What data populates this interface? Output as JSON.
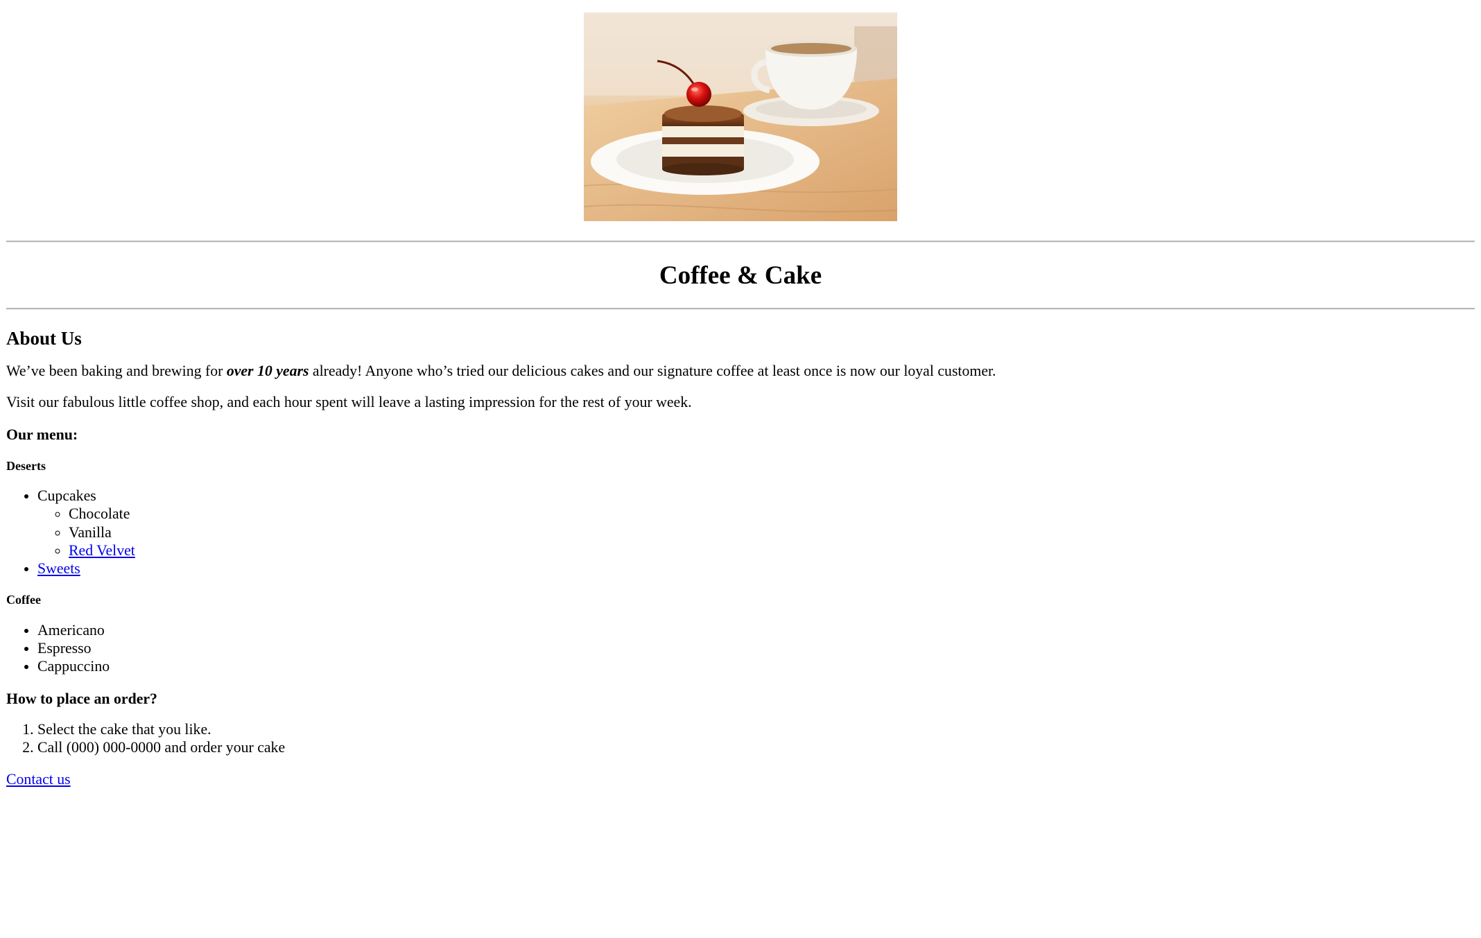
{
  "page": {
    "hero_alt": "Cake with a cherry on a plate and a cup of coffee",
    "title": "Coffee & Cake"
  },
  "about": {
    "heading": "About Us",
    "p1_pre": "We’ve been baking and brewing for ",
    "p1_em": "over 10 years",
    "p1_post": " already! Anyone who’s tried our delicious cakes and our signature coffee at least once is now our loyal customer.",
    "p2": "Visit our fabulous little coffee shop, and each hour spent will leave a lasting impression for the rest of your week."
  },
  "menu": {
    "heading": "Our menu:",
    "deserts": {
      "heading": "Deserts",
      "cupcakes_label": "Cupcakes",
      "cupcakes": [
        "Chocolate",
        "Vanilla"
      ],
      "red_velvet_link": "Red Velvet",
      "sweets_link": "Sweets"
    },
    "coffee": {
      "heading": "Coffee",
      "items": [
        "Americano",
        "Espresso",
        "Cappuccino"
      ]
    }
  },
  "order": {
    "heading": "How to place an order?",
    "steps": [
      "Select the cake that you like.",
      "Call (000) 000-0000 and order your cake"
    ]
  },
  "footer": {
    "contact_link": "Contact us"
  },
  "colors": {
    "link": "#0000ee",
    "text": "#000000",
    "rule": "#b8b8b8"
  }
}
